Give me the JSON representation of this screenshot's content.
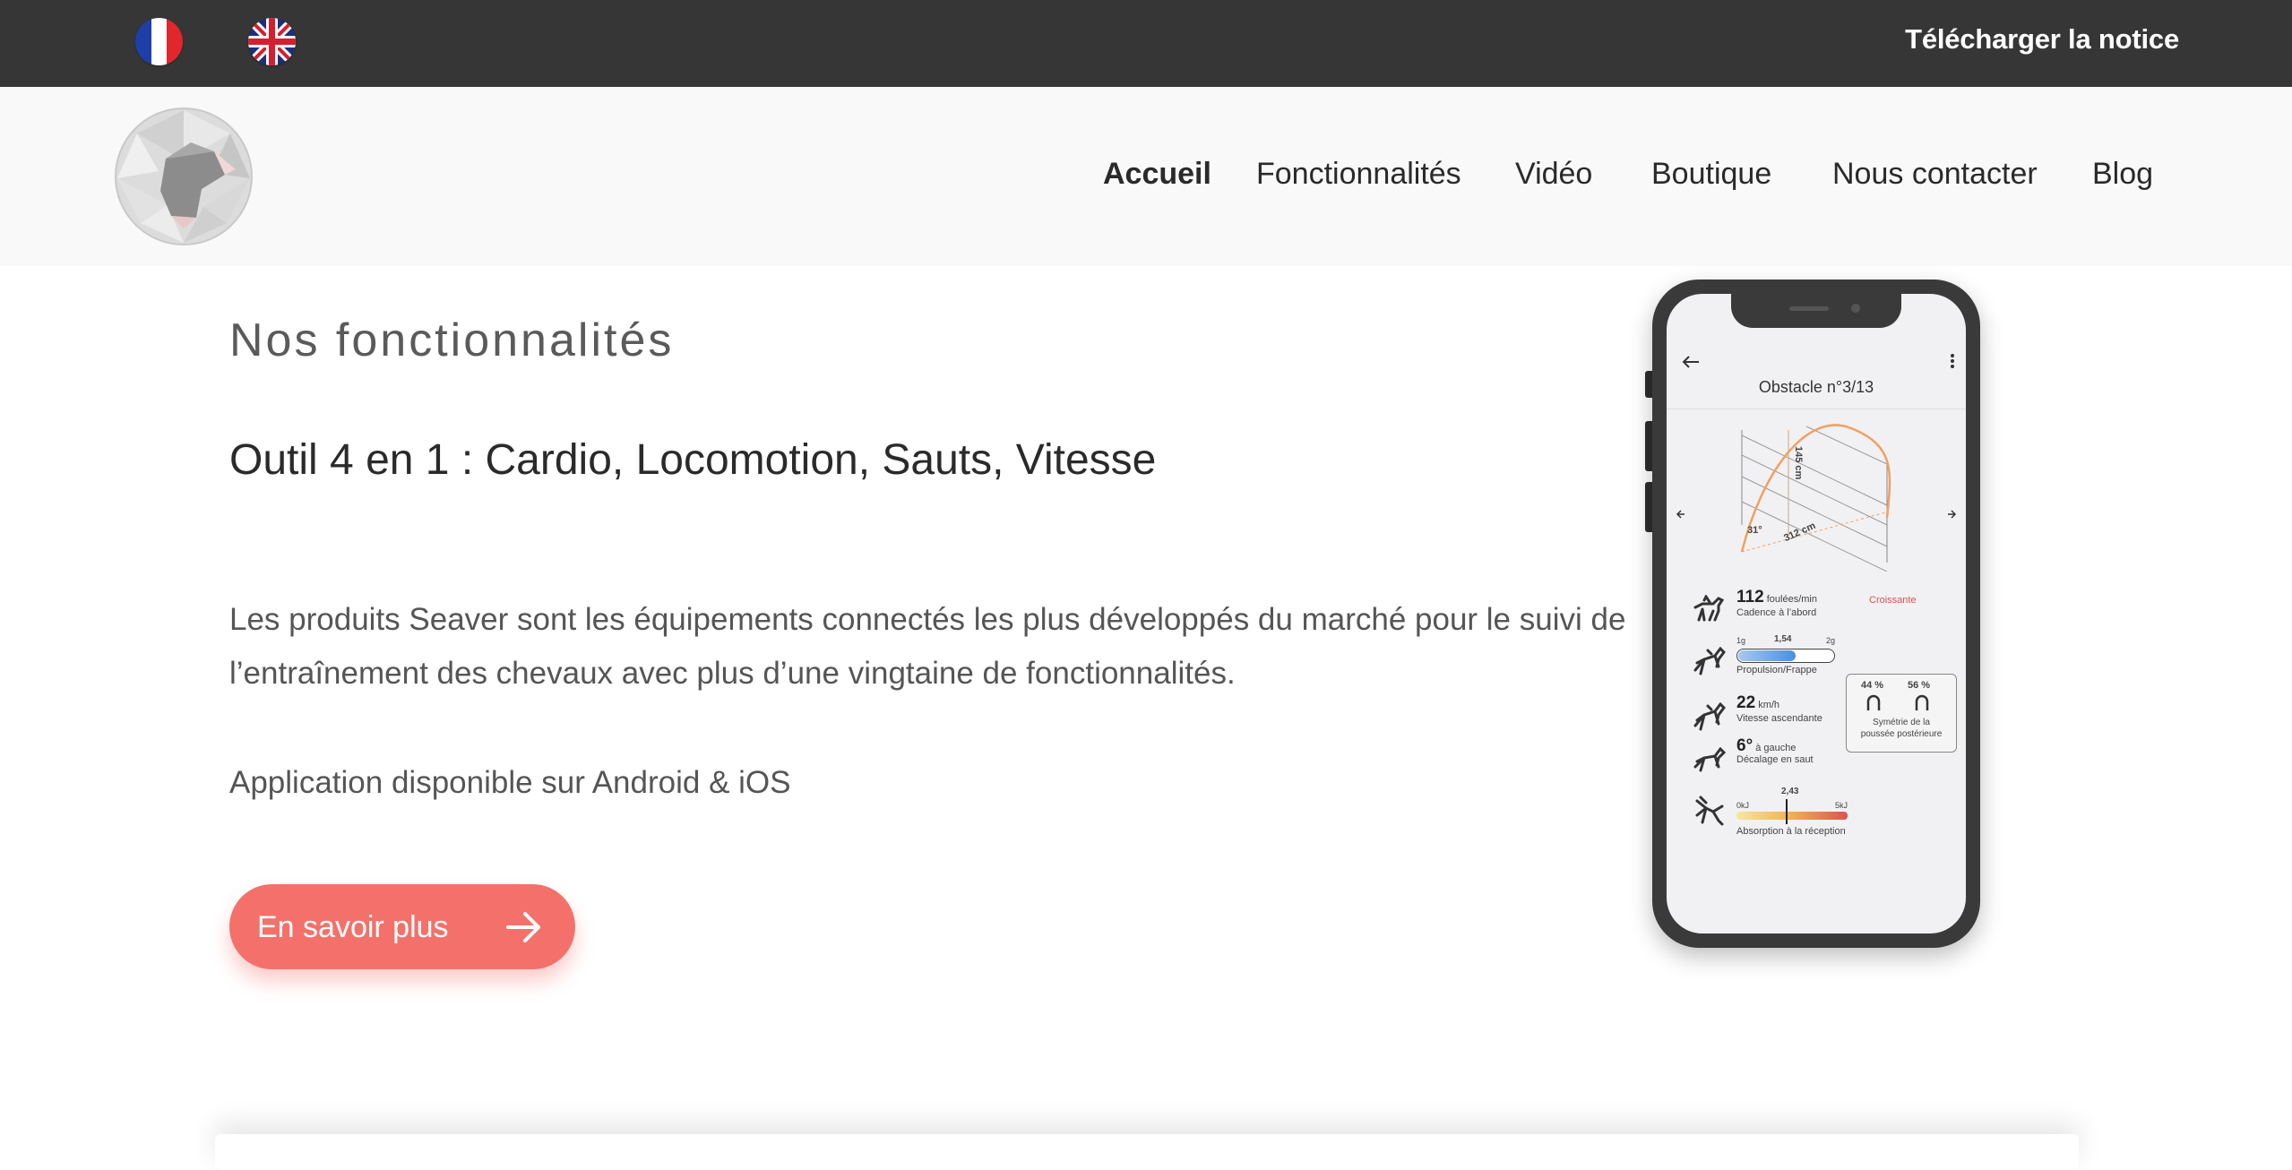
{
  "topbar": {
    "flags": [
      {
        "name": "French",
        "icon": "france-flag-icon"
      },
      {
        "name": "English",
        "icon": "uk-flag-icon"
      }
    ],
    "download_label": "Télécharger la notice"
  },
  "nav": {
    "logo_icon": "seaver-logo-icon",
    "items": [
      {
        "label": "Accueil",
        "active": true
      },
      {
        "label": "Fonctionnalités",
        "active": false
      },
      {
        "label": "Vidéo",
        "active": false
      },
      {
        "label": "Boutique",
        "active": false
      },
      {
        "label": "Nous contacter",
        "active": false
      },
      {
        "label": "Blog",
        "active": false
      }
    ]
  },
  "main": {
    "section_title": "Nos fonctionnalités",
    "subtitle": "Outil 4 en 1 : Cardio, Locomotion, Sauts, Vitesse",
    "paragraph_1": "Les produits Seaver sont les équipements connectés les plus développés du marché pour le suivi de l’entraînement des chevaux avec plus d’une vingtaine de fonctionnalités.",
    "paragraph_2": "Application disponible sur Android & iOS",
    "cta_label": "En savoir plus",
    "cta_icon": "arrow-right-icon"
  },
  "phone": {
    "title": "Obstacle n°3/13",
    "jump": {
      "height": "145 cm",
      "length": "312 cm",
      "angle": "31°"
    },
    "metrics": {
      "cadence_value": "112",
      "cadence_unit": "foulées/min",
      "cadence_label": "Cadence à l’abord",
      "cadence_trend": "Croissante",
      "propulsion_min": "1g",
      "propulsion_value": "1,54",
      "propulsion_max": "2g",
      "propulsion_label": "Propulsion/Frappe",
      "speed_value": "22",
      "speed_unit": "km/h",
      "speed_label": "Vitesse ascendante",
      "offset_value": "6°",
      "offset_unit": "à gauche",
      "offset_label": "Décalage en saut",
      "symmetry_left": "44 %",
      "symmetry_right": "56 %",
      "symmetry_label_1": "Symétrie de la",
      "symmetry_label_2": "poussée postérieure",
      "absorption_min": "0kJ",
      "absorption_value": "2,43",
      "absorption_max": "5kJ",
      "absorption_label": "Absorption à la réception"
    },
    "colors": {
      "accent": "#f0a060",
      "blue": "#4a8fe0",
      "red": "#e05050"
    }
  },
  "colors": {
    "topbar": "#363636",
    "header": "#f9f9f9",
    "cta": "#f3716a"
  }
}
